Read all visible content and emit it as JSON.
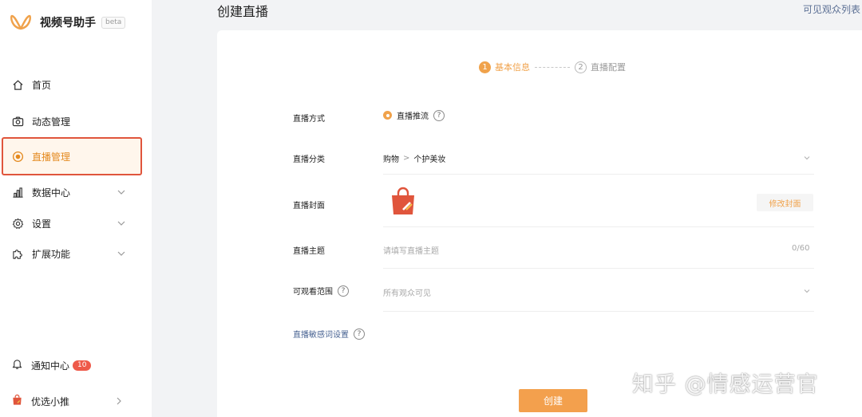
{
  "brand": {
    "name": "视频号助手",
    "badge": "beta"
  },
  "sidebar": {
    "items": [
      {
        "label": "首页"
      },
      {
        "label": "动态管理"
      },
      {
        "label": "直播管理"
      },
      {
        "label": "数据中心"
      },
      {
        "label": "设置"
      },
      {
        "label": "扩展功能"
      }
    ],
    "active": "直播管理",
    "notice": {
      "label": "通知中心",
      "count": "10"
    },
    "promo": {
      "label": "优选小推"
    }
  },
  "header": {
    "title": "创建直播",
    "link": "可见观众列表"
  },
  "steps": [
    {
      "num": "1",
      "label": "基本信息",
      "state": "current"
    },
    {
      "num": "2",
      "label": "直播配置",
      "state": "pending"
    }
  ],
  "form": {
    "mode": {
      "label": "直播方式",
      "value": "直播推流"
    },
    "category": {
      "label": "直播分类",
      "primary": "购物",
      "separator": ">",
      "secondary": "个护美妆"
    },
    "cover": {
      "label": "直播封面",
      "button": "修改封面"
    },
    "topic": {
      "label": "直播主题",
      "placeholder": "请填写直播主题",
      "counter": "0/60"
    },
    "visibility": {
      "label": "可观看范围",
      "value": "所有观众可见"
    },
    "sensitive_link": "直播敏感词设置",
    "help_mark": "?",
    "submit": "创建"
  },
  "watermark": "知乎 @情感运营官",
  "colors": {
    "accent": "#f0a24b",
    "active_border": "#e0553c",
    "badge": "#ee5a4a",
    "link": "#4a6493"
  }
}
